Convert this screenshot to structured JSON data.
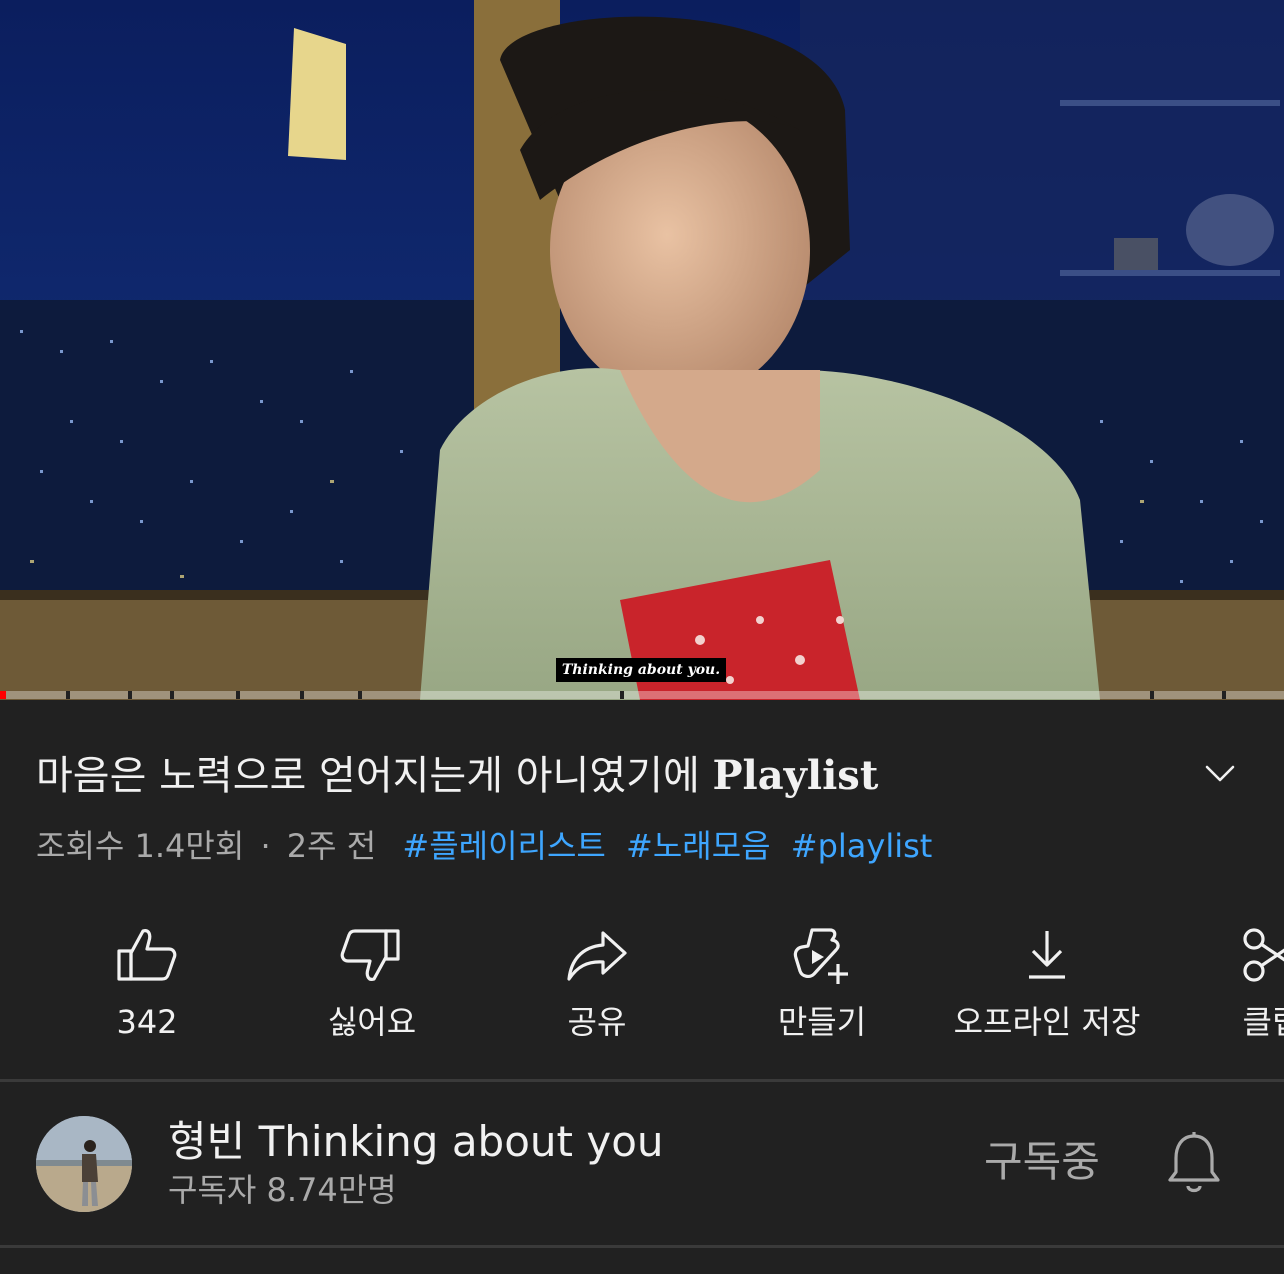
{
  "video": {
    "caption": "Thinking about you.",
    "progress_fraction": 0.005
  },
  "title": {
    "korean": "마음은 노력으로 얻어지는게 아니였기에",
    "english": "Playlist"
  },
  "meta": {
    "views": "조회수 1.4만회",
    "separator": "·",
    "age": "2주 전",
    "hashtags": [
      "#플레이리스트",
      "#노래모음",
      "#playlist"
    ]
  },
  "actions": [
    {
      "label": "342",
      "icon": "thumbs-up-icon"
    },
    {
      "label": "싫어요",
      "icon": "thumbs-down-icon"
    },
    {
      "label": "공유",
      "icon": "share-icon"
    },
    {
      "label": "만들기",
      "icon": "remix-create-icon"
    },
    {
      "label": "오프라인 저장",
      "icon": "download-icon"
    },
    {
      "label": "클립",
      "icon": "scissors-icon"
    }
  ],
  "channel": {
    "name": "형빈 Thinking about you",
    "subscribers": "구독자 8.74만명",
    "subscribe_state": "구독중",
    "bell_icon": "bell-icon"
  },
  "colors": {
    "background": "#212121",
    "hashtag": "#3ea6ff",
    "secondary_text": "#aaaaaa",
    "progress": "#ff0000"
  }
}
